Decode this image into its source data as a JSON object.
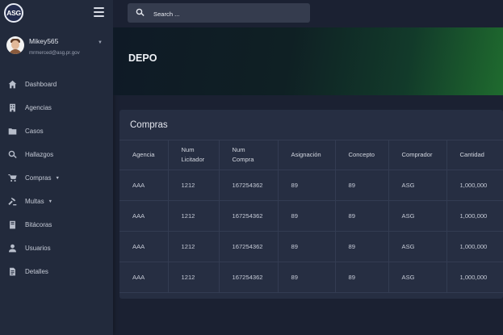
{
  "app": {
    "logo_text": "ASG"
  },
  "user": {
    "name": "Mikey565",
    "email": "mrmerced@asg.pr.gov"
  },
  "search": {
    "placeholder": "Search ..."
  },
  "sidebar": {
    "items": [
      {
        "label": "Dashboard",
        "icon": "home-icon",
        "has_caret": false
      },
      {
        "label": "Agencias",
        "icon": "building-icon",
        "has_caret": false
      },
      {
        "label": "Casos",
        "icon": "folder-icon",
        "has_caret": false
      },
      {
        "label": "Hallazgos",
        "icon": "search-icon",
        "has_caret": false
      },
      {
        "label": "Compras",
        "icon": "cart-icon",
        "has_caret": true
      },
      {
        "label": "Multas",
        "icon": "gavel-icon",
        "has_caret": true
      },
      {
        "label": "Bitácoras",
        "icon": "book-icon",
        "has_caret": false
      },
      {
        "label": "Usuarios",
        "icon": "user-icon",
        "has_caret": false
      },
      {
        "label": "Detalles",
        "icon": "document-icon",
        "has_caret": false
      }
    ]
  },
  "banner": {
    "title": "DEPO"
  },
  "card": {
    "title": "Compras",
    "columns": [
      "Agencia",
      "Num\nLicitador",
      "Num\nCompra",
      "Asignación",
      "Concepto",
      "Comprador",
      "Cantidad"
    ],
    "rows": [
      [
        "AAA",
        "1212",
        "167254362",
        "89",
        "89",
        "ASG",
        "1,000,000"
      ],
      [
        "AAA",
        "1212",
        "167254362",
        "89",
        "89",
        "ASG",
        "1,000,000"
      ],
      [
        "AAA",
        "1212",
        "167254362",
        "89",
        "89",
        "ASG",
        "1,000,000"
      ],
      [
        "AAA",
        "1212",
        "167254362",
        "89",
        "89",
        "ASG",
        "1,000,000"
      ]
    ]
  },
  "colors": {
    "sidebar_bg": "#222a3c",
    "page_bg": "#1b2132",
    "card_bg": "#262e42",
    "banner_accent": "#1f6b2e"
  }
}
